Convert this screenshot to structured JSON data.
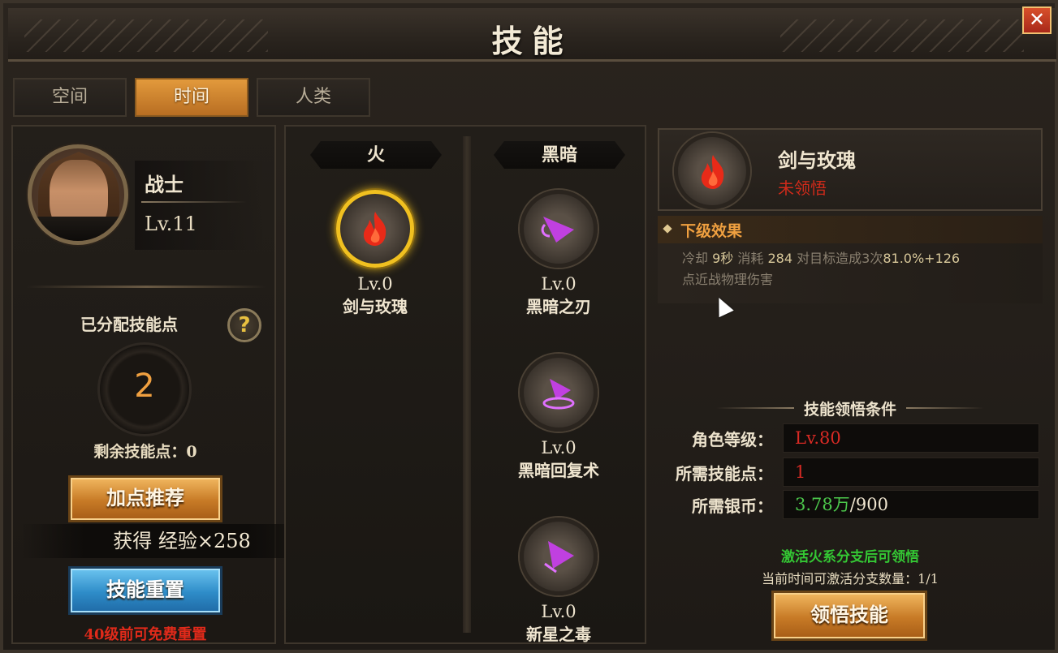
{
  "window": {
    "title": "技能",
    "close_label": "✕"
  },
  "tabs": [
    {
      "label": "空间",
      "active": false
    },
    {
      "label": "时间",
      "active": true
    },
    {
      "label": "人类",
      "active": false
    }
  ],
  "hero": {
    "class_name": "战士",
    "level": "Lv.11"
  },
  "skill_points": {
    "allocated_label": "已分配技能点",
    "allocated_value": "2",
    "remaining_text": "剩余技能点：0",
    "help_label": "?"
  },
  "buttons": {
    "recommend": "加点推荐",
    "reset": "技能重置",
    "learn": "领悟技能"
  },
  "reward_text": "获得 经验×258",
  "reset_note": "40级前可免费重置",
  "branches": [
    {
      "name": "火"
    },
    {
      "name": "黑暗"
    }
  ],
  "skills": [
    {
      "level": "Lv.0",
      "name": "剑与玫瑰",
      "icon": "fire-icon",
      "selected": true
    },
    {
      "level": "Lv.0",
      "name": "黑暗之刃",
      "icon": "dark-blade-icon"
    },
    {
      "level": "Lv.0",
      "name": "黑暗回复术",
      "icon": "dark-heal-icon"
    },
    {
      "level": "Lv.0",
      "name": "新星之毒",
      "icon": "nova-poison-icon"
    }
  ],
  "detail": {
    "skill_name": "剑与玫瑰",
    "status": "未领悟",
    "effect_title": "下级效果",
    "effect": {
      "cooldown_label": "冷却",
      "cooldown_value": "9秒",
      "cost_label": "消耗",
      "cost_value": "284",
      "desc_prefix": "对目标造成3次",
      "desc_value": "81.0%+126",
      "desc_suffix": "点近战物理伤害"
    },
    "conditions_title": "技能领悟条件",
    "conditions": [
      {
        "label": "角色等级：",
        "value": "Lv.80",
        "color": "#d82a24"
      },
      {
        "label": "所需技能点：",
        "value": "1",
        "color": "#d82a24"
      },
      {
        "label": "所需银币：",
        "value_have": "3.78万",
        "value_need": "/900"
      }
    ],
    "activate_note": "激活火系分支后可领悟",
    "branch_count_label": "当前时间可激活分支数量：",
    "branch_count_value": "1/1"
  },
  "colors": {
    "accent_orange": "#c77a26",
    "accent_blue": "#2e8cc8",
    "warning_red": "#d82a24",
    "ok_green": "#4cc84c",
    "fire_red": "#e02a1a",
    "dark_purple": "#b040d8"
  }
}
